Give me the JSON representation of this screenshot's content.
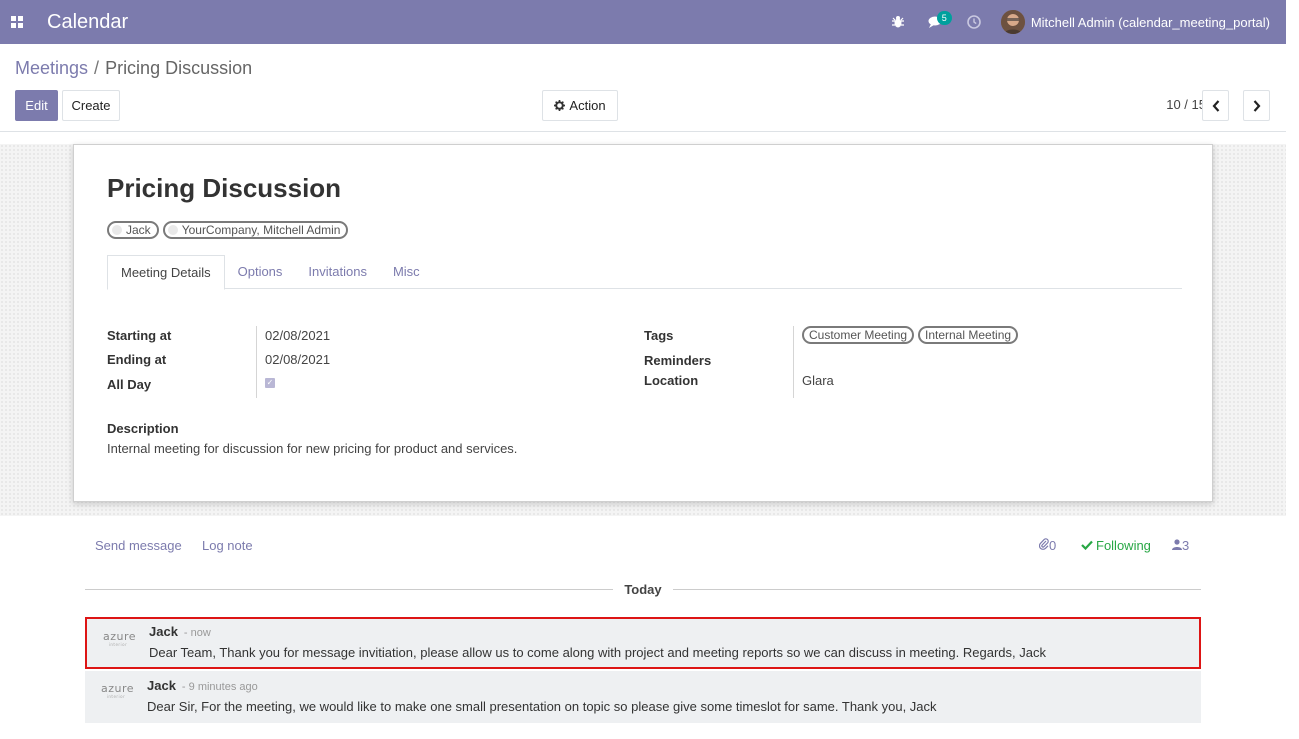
{
  "topbar": {
    "app_title": "Calendar",
    "message_count": "5",
    "user_name": "Mitchell Admin (calendar_meeting_portal)",
    "color": "#7c7bad"
  },
  "breadcrumb": {
    "parent": "Meetings",
    "separator": "/",
    "current": "Pricing Discussion"
  },
  "buttons": {
    "edit": "Edit",
    "create": "Create",
    "action": "Action"
  },
  "pager": {
    "value": "10 / 15"
  },
  "record": {
    "title": "Pricing Discussion",
    "attendees": [
      "Jack",
      "YourCompany, Mitchell Admin"
    ],
    "tabs": [
      "Meeting Details",
      "Options",
      "Invitations",
      "Misc"
    ],
    "fields": {
      "starting_at_label": "Starting at",
      "starting_at": "02/08/2021",
      "ending_at_label": "Ending at",
      "ending_at": "02/08/2021",
      "all_day_label": "All Day",
      "all_day": true,
      "tags_label": "Tags",
      "tags": [
        "Customer Meeting",
        "Internal Meeting"
      ],
      "reminders_label": "Reminders",
      "location_label": "Location",
      "location": "Glara",
      "description_label": "Description",
      "description": "Internal meeting for discussion for new pricing for product and services."
    }
  },
  "chatter": {
    "send_message": "Send message",
    "log_note": "Log note",
    "attachments": "0",
    "following": "Following",
    "followers": "3",
    "date_separator": "Today",
    "messages": [
      {
        "author": "Jack",
        "time": "- now",
        "body": "Dear Team, Thank you for message invitiation, please allow us to come along with project and meeting reports so we can discuss in meeting. Regards, Jack",
        "avatar_text": "azure",
        "avatar_sub": "interior"
      },
      {
        "author": "Jack",
        "time": "- 9 minutes ago",
        "body": "Dear Sir, For the meeting, we would like to make one small presentation on topic so please give some timeslot for same. Thank you, Jack",
        "avatar_text": "azure",
        "avatar_sub": "interior"
      }
    ]
  }
}
